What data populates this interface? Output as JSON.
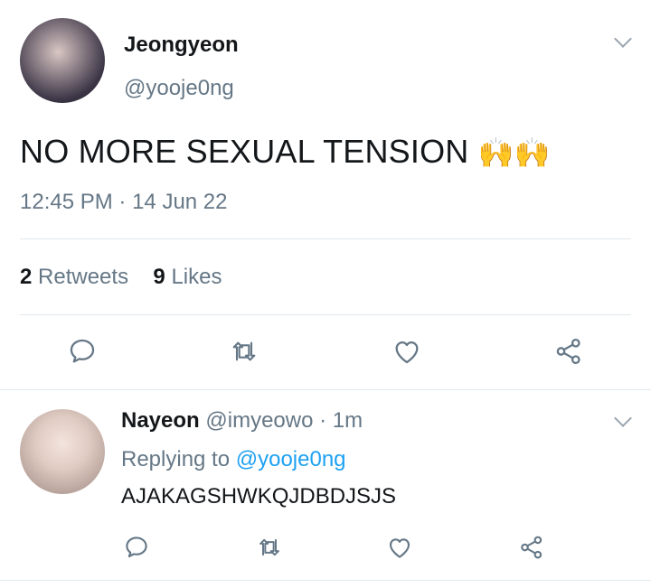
{
  "tweet": {
    "author_name": "Jeongyeon",
    "author_handle": "@yooje0ng",
    "text": "NO MORE SEXUAL TENSION",
    "emoji": "🙌🙌",
    "timestamp": "12:45 PM",
    "separator": "·",
    "date": "14 Jun 22",
    "retweets_count": "2",
    "retweets_label": "Retweets",
    "likes_count": "9",
    "likes_label": "Likes"
  },
  "reply": {
    "author_name": "Nayeon",
    "author_handle": "@imyeowo",
    "separator": "·",
    "time_ago": "1m",
    "replying_to_label": "Replying to",
    "replying_to_handle": "@yooje0ng",
    "text": "AJAKAGSHWKQJDBDJSJS"
  },
  "icons": {
    "reply": "reply-icon",
    "retweet": "retweet-icon",
    "like": "heart-icon",
    "share": "share-icon",
    "more": "chevron-down-icon"
  },
  "colors": {
    "text": "#14171a",
    "secondary": "#657786",
    "link": "#1da1f2",
    "divider": "#e1e8ed",
    "icon": "#657786"
  }
}
